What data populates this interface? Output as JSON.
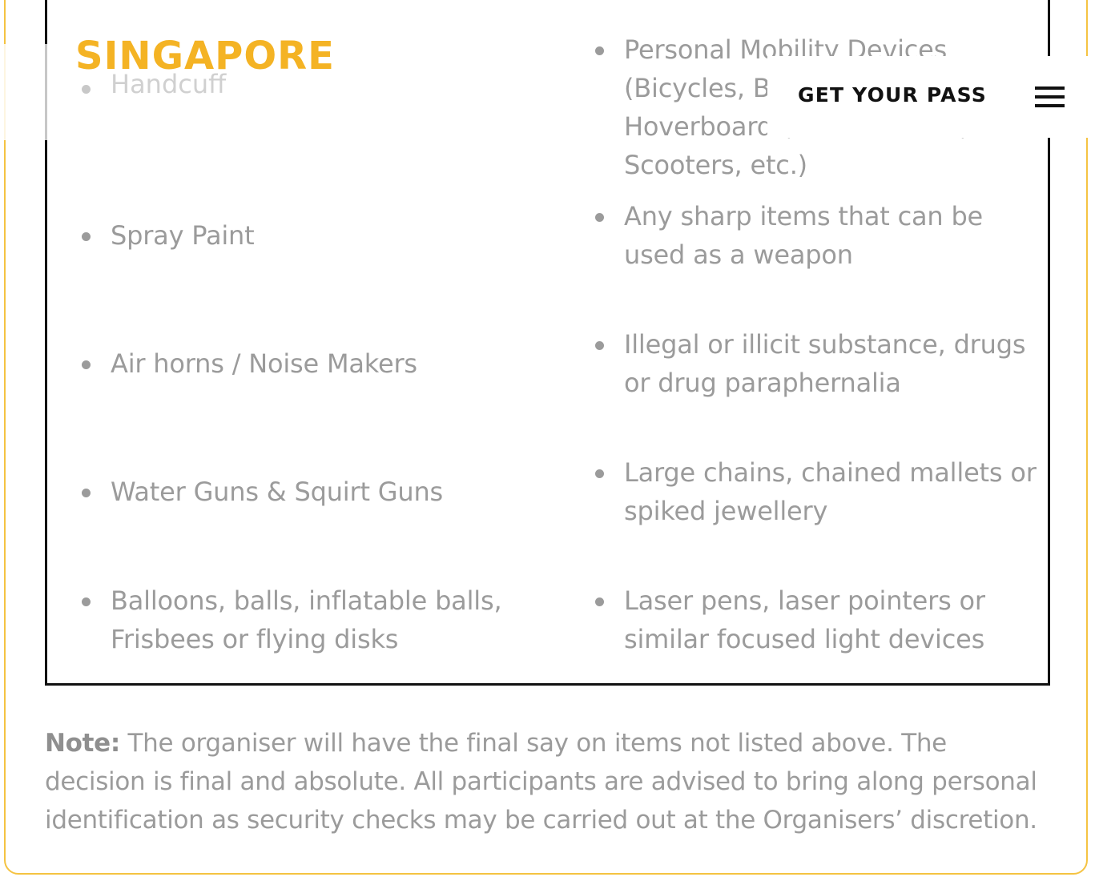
{
  "header": {
    "logo_text": "SINGAPORE",
    "cta_label": "GET YOUR PASS",
    "menu_icon": "hamburger-menu-icon",
    "logo_color": "#f4b324"
  },
  "prohibited_items": {
    "left": [
      "Handcuff",
      "Spray Paint",
      "Air horns / Noise Makers",
      "Water Guns & Squirt Guns",
      "Balloons, balls, inflatable balls, Frisbees or flying disks"
    ],
    "right": [
      "Personal Mobility Devices (Bicycles, Booster Boards, Hoverboards, Skateboards, Scooters, etc.)",
      "Any sharp items that can be used as a weapon",
      "Illegal or illicit substance, drugs or drug paraphernalia",
      "Large chains, chained mallets or spiked jewellery",
      "Laser pens, laser pointers or similar focused light devices"
    ]
  },
  "note": {
    "label": "Note:",
    "text": "The organiser will have the final say on items not listed above. The decision is final and absolute. All participants are advised to bring along personal identification as security checks may be carried out at the Organisers’ discretion."
  },
  "colors": {
    "frame_yellow": "#f5c342",
    "text_gray": "#9b9b9b",
    "box_border": "#111111"
  }
}
